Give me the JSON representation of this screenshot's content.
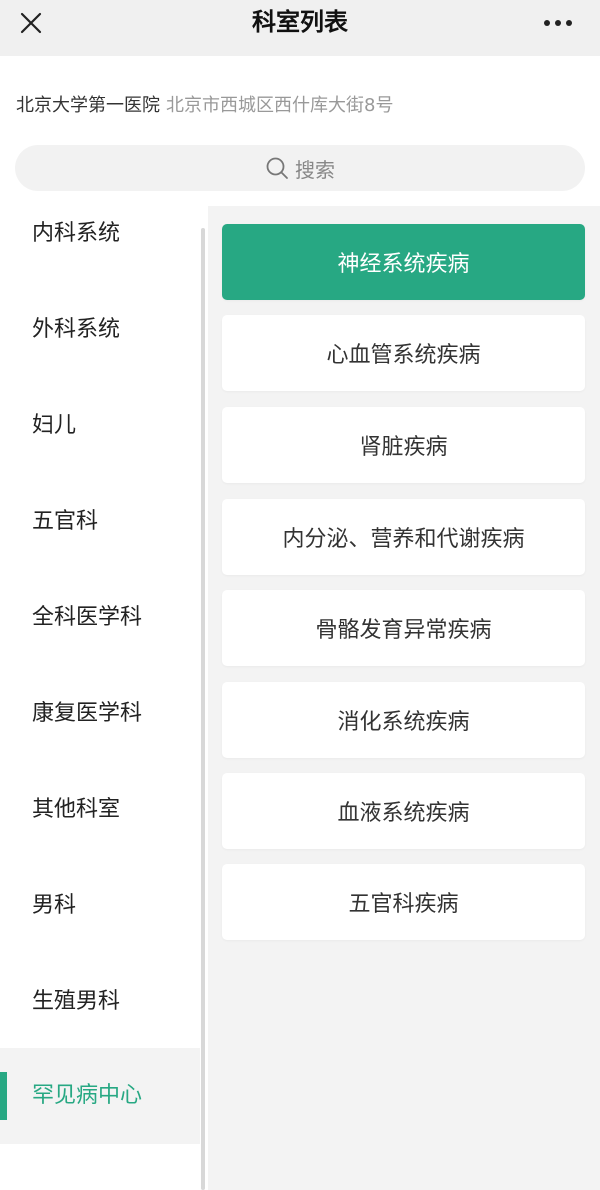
{
  "header": {
    "title": "科室列表",
    "close_icon": "close-icon",
    "more_icon": "more-dots-icon"
  },
  "hospital": {
    "name": "北京大学第一医院",
    "address": "北京市西城区西什库大街8号"
  },
  "search": {
    "placeholder": "搜索",
    "icon": "search-icon"
  },
  "categories": [
    {
      "label": "内科系统"
    },
    {
      "label": "外科系统"
    },
    {
      "label": "妇儿"
    },
    {
      "label": "五官科"
    },
    {
      "label": "全科医学科"
    },
    {
      "label": "康复医学科"
    },
    {
      "label": "其他科室"
    },
    {
      "label": "男科"
    },
    {
      "label": "生殖男科"
    },
    {
      "label": "罕见病中心"
    }
  ],
  "active_category": "罕见病中心",
  "departments": [
    {
      "label": "神经系统疾病"
    },
    {
      "label": "心血管系统疾病"
    },
    {
      "label": "肾脏疾病"
    },
    {
      "label": "内分泌、营养和代谢疾病"
    },
    {
      "label": "骨骼发育异常疾病"
    },
    {
      "label": "消化系统疾病"
    },
    {
      "label": "血液系统疾病"
    },
    {
      "label": "五官科疾病"
    }
  ],
  "active_department": "神经系统疾病",
  "colors": {
    "accent": "#27a883",
    "header_bg": "#f0f0f0",
    "panel_bg": "#f3f3f3",
    "muted_text": "#999999"
  }
}
